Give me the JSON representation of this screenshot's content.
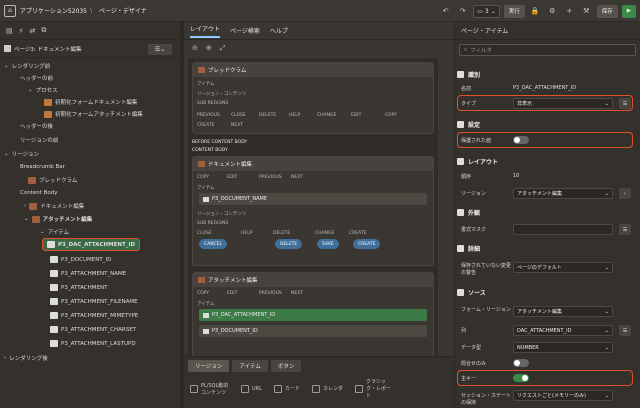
{
  "topbar": {
    "app": "アプリケーション52035",
    "separator": "\\",
    "page": "ページ・デザイナ",
    "page_no": "3",
    "run": "実行",
    "save": "保存"
  },
  "left": {
    "page_label": "ページ3: ドキュメント編集",
    "tree": [
      "レンダリング前",
      "ヘッダーの前",
      "プロセス",
      "初期化フォームドキュメント編集",
      "初期化フォームアタッチメント編集",
      "ヘッダーの後",
      "リージョンの前",
      "リージョン",
      "Breadcrumb Bar",
      "ブレッドクラム",
      "Content Body",
      "ドキュメント編集",
      "アタッチメント編集",
      "アイテム",
      "P3_DAC_ATTACHMENT_ID",
      "P3_DOCUMENT_ID",
      "P3_ATTACHMENT_NAME",
      "P3_ATTACHMENT",
      "P3_ATTACHMENT_FILENAME",
      "P3_ATTACHMENT_MIMETYPE",
      "P3_ATTACHMENT_CHARSET",
      "P3_ATTACHMENT_LASTUPD",
      "レンダリング後"
    ]
  },
  "center": {
    "tabs": [
      "レイアウト",
      "ページ検索",
      "ヘルプ"
    ],
    "breadcrumb_region": "ブレッドクラム",
    "items_label": "アイテム",
    "region_content": "リージョン・コンテンツ",
    "sub_regions": "SUB REGIONS",
    "bc_buttons": [
      "PREVIOUS",
      "CLOSE",
      "DELETE",
      "HELP",
      "CHANGE",
      "EDIT",
      "COPY",
      "CREATE",
      "NEXT"
    ],
    "before_cb": "BEFORE CONTENT BODY",
    "content_body": "CONTENT BODY",
    "doc_region": "ドキュメント編集",
    "doc_top": [
      "COPY",
      "EDIT",
      "PREVIOUS",
      "NEXT"
    ],
    "doc_item": "P3_DOCUMENT_NAME",
    "doc_bottom": [
      "CLOSE",
      "HELP",
      "DELETE",
      "CHANGE",
      "CREATE"
    ],
    "doc_pills": [
      "CANCEL",
      "DELETE",
      "SAVE",
      "CREATE"
    ],
    "att_region": "アタッチメント編集",
    "att_top": [
      "COPY",
      "EDIT",
      "PREVIOUS",
      "NEXT"
    ],
    "att_items": [
      "P3_DAC_ATTACHMENT_ID",
      "P3_DOCUMENT_ID"
    ],
    "bottom_tabs": [
      "リージョン",
      "アイテム",
      "ボタン"
    ],
    "components": [
      "PL/SQL動的コンテンツ",
      "URL",
      "カード",
      "カレンダ",
      "クラシック・レポート"
    ]
  },
  "right": {
    "title": "ページ・アイテム",
    "filter_placeholder": "フィルタ",
    "sections": [
      "識別",
      "設定",
      "レイアウト",
      "外観",
      "詳細",
      "ソース"
    ],
    "name_label": "名前",
    "name_value": "P3_DAC_ATTACHMENT_ID",
    "type_label": "タイプ",
    "type_value": "非表示",
    "protected_label": "保護された値",
    "seq_label": "順序",
    "seq_value": "10",
    "region_label": "リージョン",
    "region_value": "アタッチメント編集",
    "template_label": "書式マスク",
    "warn_label": "保存されていない変更の警告",
    "warn_value": "ページのデフォルト",
    "form_region_label": "フォーム・リージョン",
    "form_region_value": "アタッチメント編集",
    "column_label": "列",
    "column_value": "DAC_ATTACHMENT_ID",
    "datatype_label": "データ型",
    "datatype_value": "NUMBER",
    "query_only_label": "問合せのみ",
    "pk_label": "主キー",
    "session_label": "セッション・ステートの保持",
    "session_value": "リクエストごと(メモリーのみ)"
  }
}
